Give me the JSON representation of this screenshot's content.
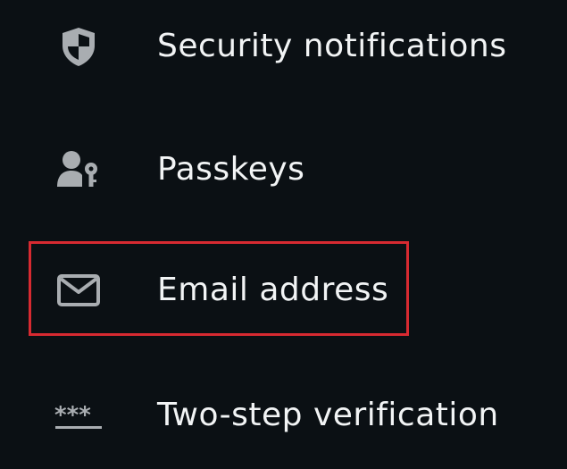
{
  "menu": {
    "items": [
      {
        "label": "Security notifications",
        "icon": "shield-icon"
      },
      {
        "label": "Passkeys",
        "icon": "passkey-icon"
      },
      {
        "label": "Email address",
        "icon": "envelope-icon"
      },
      {
        "label": "Two-step verification",
        "icon": "password-asterisks-icon"
      }
    ]
  },
  "highlight": {
    "color": "#d72a31",
    "target": "Email address"
  },
  "colors": {
    "background": "#0b1014",
    "text": "#f2f4f5",
    "icon": "#a9adb1"
  }
}
